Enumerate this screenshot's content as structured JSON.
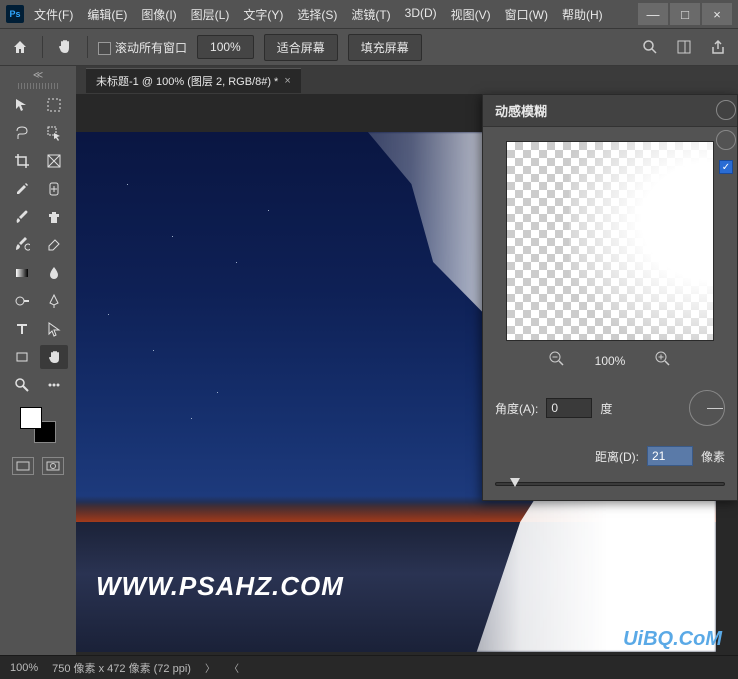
{
  "logo": "Ps",
  "menu": [
    "文件(F)",
    "编辑(E)",
    "图像(I)",
    "图层(L)",
    "文字(Y)",
    "选择(S)",
    "滤镜(T)",
    "3D(D)",
    "视图(V)",
    "窗口(W)",
    "帮助(H)"
  ],
  "win": {
    "min": "—",
    "max": "□",
    "close": "×"
  },
  "options": {
    "scrollAll": "滚动所有窗口",
    "zoom": "100%",
    "fit": "适合屏幕",
    "fill": "填充屏幕"
  },
  "tab": {
    "label": "未标题-1 @ 100% (图层 2, RGB/8#) *"
  },
  "tools": [
    "move-tool",
    "marquee-tool",
    "lasso-tool",
    "quick-select-tool",
    "crop-tool",
    "frame-tool",
    "eyedropper-tool",
    "healing-tool",
    "brush-tool",
    "clone-tool",
    "history-brush-tool",
    "eraser-tool",
    "gradient-tool",
    "blur-tool",
    "dodge-tool",
    "pen-tool",
    "type-tool",
    "path-select-tool",
    "rectangle-tool",
    "hand-tool",
    "zoom-tool",
    "edit-toolbar"
  ],
  "watermark": "WWW.PSAHZ.COM",
  "dialog": {
    "title": "动感模糊",
    "previewZoom": "100%",
    "angle": {
      "label": "角度(A):",
      "value": "0",
      "unit": "度"
    },
    "distance": {
      "label": "距离(D):",
      "value": "21",
      "unit": "像素"
    }
  },
  "status": {
    "zoom": "100%",
    "docinfo": "750 像素 x 472 像素 (72 ppi)"
  },
  "brand": "UiBQ.CoM"
}
